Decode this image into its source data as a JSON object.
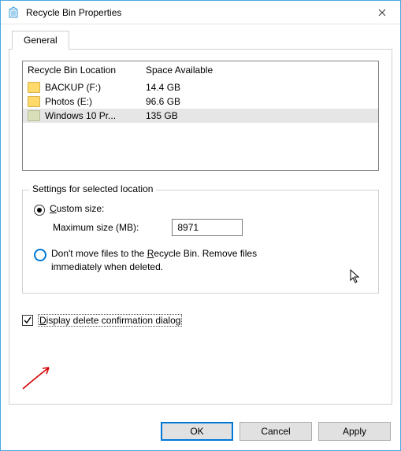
{
  "window": {
    "title": "Recycle Bin Properties",
    "icon": "recycle-bin-icon"
  },
  "tabs": [
    {
      "label": "General"
    }
  ],
  "list": {
    "headers": {
      "location": "Recycle Bin Location",
      "space": "Space Available"
    },
    "rows": [
      {
        "name": "BACKUP (F:)",
        "space": "14.4 GB",
        "selected": false,
        "dim": false
      },
      {
        "name": "Photos (E:)",
        "space": "96.6 GB",
        "selected": false,
        "dim": false
      },
      {
        "name": "Windows 10 Pr...",
        "space": "135 GB",
        "selected": true,
        "dim": true
      }
    ]
  },
  "settings": {
    "group_label": "Settings for selected location",
    "custom_size": {
      "prefix": "C",
      "rest": "ustom size:",
      "max_label": "Maximum size (MB):",
      "value": "8971",
      "checked": true
    },
    "dont_move": {
      "pre": "Don't move files to the ",
      "u": "R",
      "mid": "ecycle Bin. Remove files",
      "line2": "immediately when deleted.",
      "checked": false
    }
  },
  "confirm": {
    "prefix": "D",
    "rest": "isplay delete confirmation dialog",
    "checked": true
  },
  "buttons": {
    "ok": "OK",
    "cancel": "Cancel",
    "apply": "Apply"
  }
}
